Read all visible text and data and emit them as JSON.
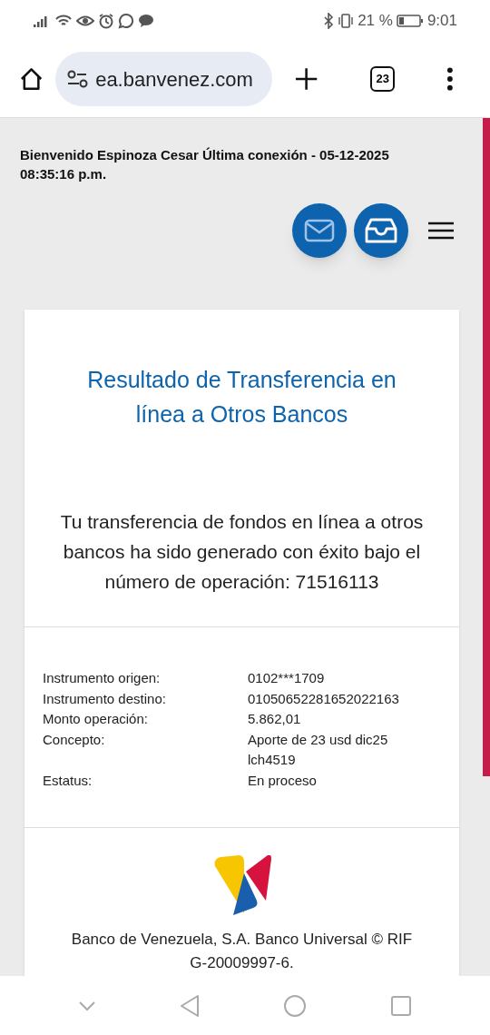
{
  "status_bar": {
    "battery_percent": "21 %",
    "time": "9:01"
  },
  "browser": {
    "url": "ea.banvenez.com",
    "tab_count": "23"
  },
  "header": {
    "welcome": "Bienvenido Espinoza Cesar Última conexión - 05-12-2025 08:35:16 p.m."
  },
  "result": {
    "title": "Resultado de Transferencia en línea a Otros Bancos",
    "message": "Tu transferencia de fondos en línea a otros bancos ha sido generado con éxito bajo el número de operación: 71516113",
    "details": [
      {
        "label": "Instrumento origen:",
        "value": "0102***1709"
      },
      {
        "label": "Instrumento destino:",
        "value": "01050652281652022163"
      },
      {
        "label": "Monto operación:",
        "value": "5.862,01"
      },
      {
        "label": "Concepto:",
        "value": "Aporte de 23 usd dic25 lch4519"
      },
      {
        "label": "Estatus:",
        "value": "En proceso"
      }
    ],
    "footer": "Banco de Venezuela, S.A. Banco Universal © RIF G-20009997-6."
  }
}
